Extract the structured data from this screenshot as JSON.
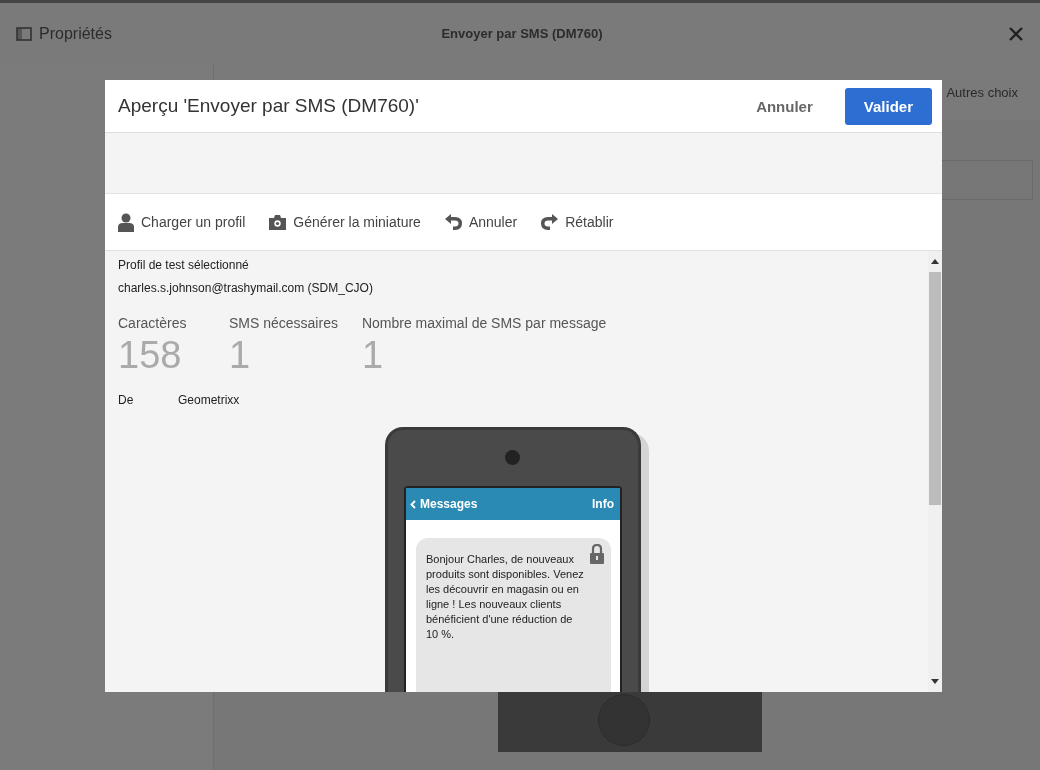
{
  "page": {
    "sidebar_title": "Propriétés",
    "title": "Envoyer par SMS (DM760)",
    "tab": "Autres choix"
  },
  "dialog": {
    "title": "Aperçu 'Envoyer par SMS (DM760)'",
    "buttons": [
      {
        "label": "Annuler",
        "kind": "secondary"
      },
      {
        "label": "Valider",
        "kind": "primary"
      }
    ],
    "toolbar": [
      {
        "label": "Charger un profil",
        "kind": "profile"
      },
      {
        "label": "Générer la miniature",
        "kind": "camera"
      },
      {
        "label": "Annuler",
        "kind": "undo"
      },
      {
        "label": "Rétablir",
        "kind": "redo"
      }
    ],
    "test_profile": {
      "label": "Profil de test sélectionné",
      "value": "charles.s.johnson@trashymail.com (SDM_CJO)"
    },
    "stats": [
      {
        "label": "Caractères",
        "value": "158"
      },
      {
        "label": "SMS nécessaires",
        "value": "1"
      },
      {
        "label": "Nombre maximal de SMS par message",
        "value": "1"
      }
    ],
    "sender": {
      "label": "De",
      "value": "Geometrixx"
    },
    "phone": {
      "back": "Messages",
      "info": "Info",
      "message": "Bonjour Charles, de nouveaux produits sont disponibles. Venez les découvrir en magasin ou en ligne ! Les nouveaux clients bénéficient d'une réduction de 10 %."
    }
  }
}
